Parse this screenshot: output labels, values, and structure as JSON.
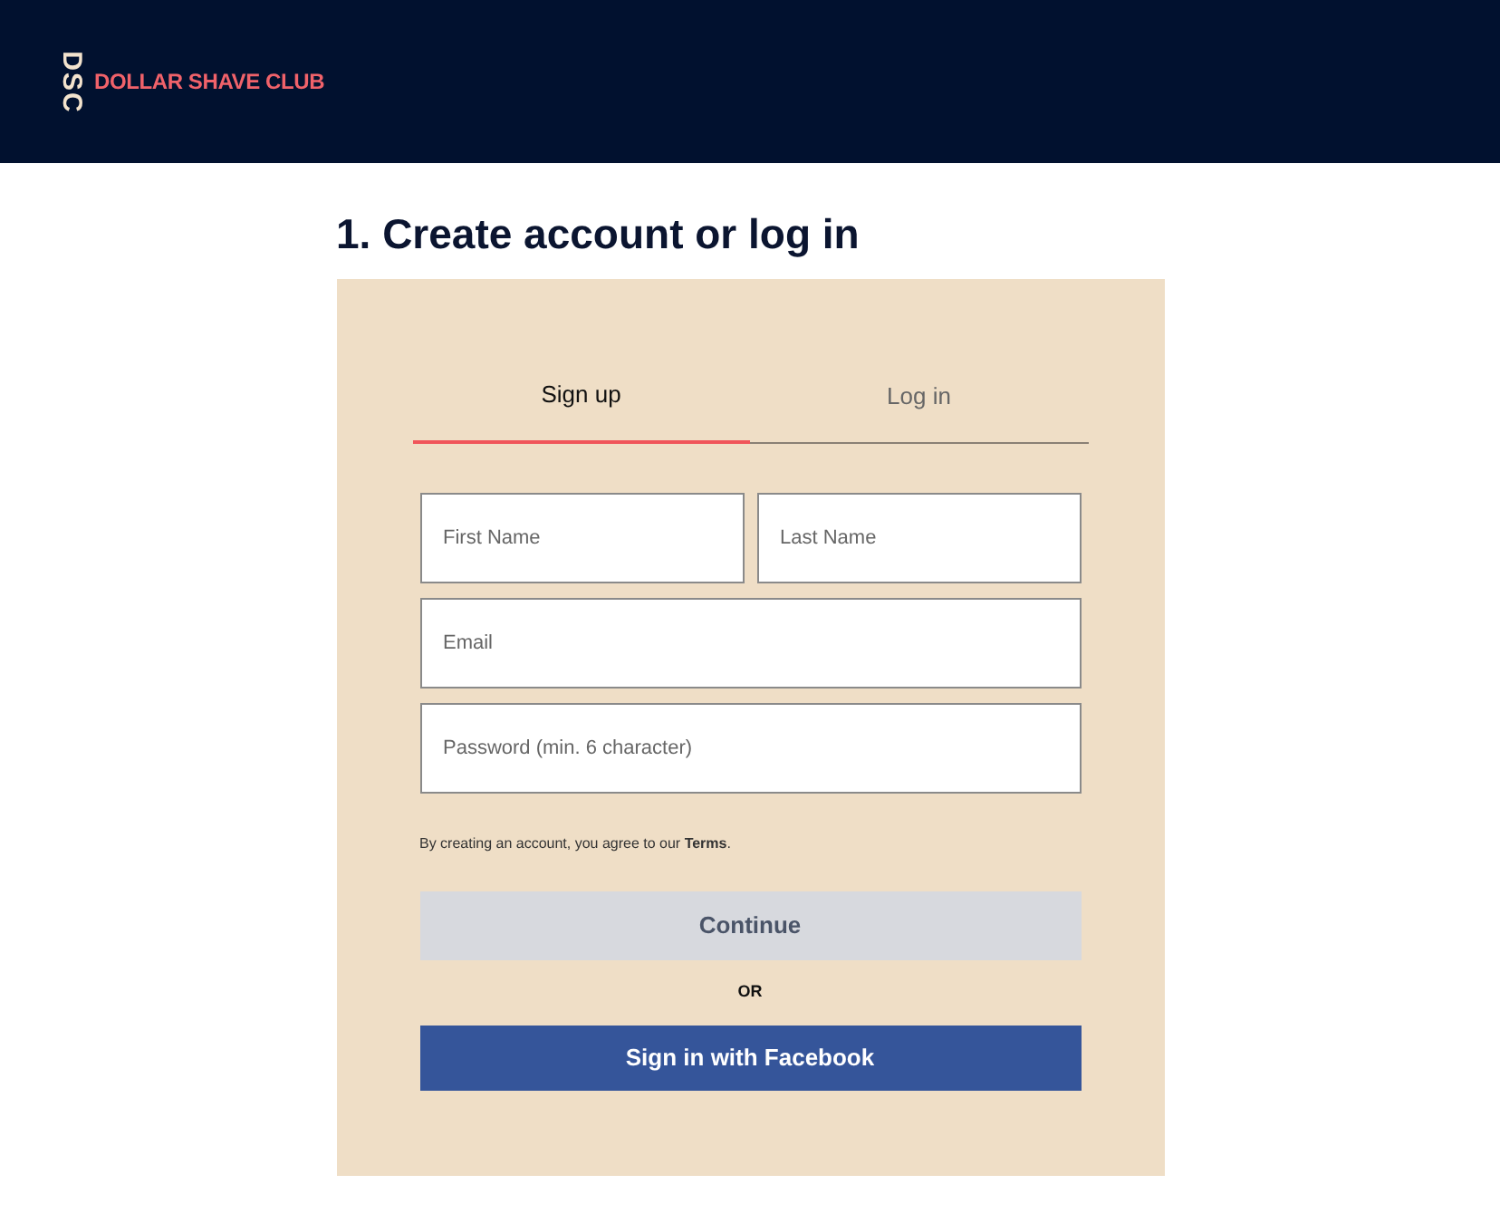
{
  "header": {
    "logo_mark": "DSC",
    "logo_text": "DOLLAR SHAVE CLUB"
  },
  "heading": "1. Create account or log in",
  "tabs": [
    {
      "label": "Sign up",
      "selected": true
    },
    {
      "label": "Log in",
      "selected": false
    }
  ],
  "fields": [
    {
      "placeholder": "First Name"
    },
    {
      "placeholder": "Last Name"
    },
    {
      "placeholder": "Email"
    },
    {
      "placeholder": "Password (min. 6 character)"
    }
  ],
  "terms": "By creating an account, you agree to our **Terms**.",
  "continue_button": {
    "label": "Continue",
    "disabled": true
  },
  "separator": "OR",
  "facebook_button": "Sign in with Facebook"
}
